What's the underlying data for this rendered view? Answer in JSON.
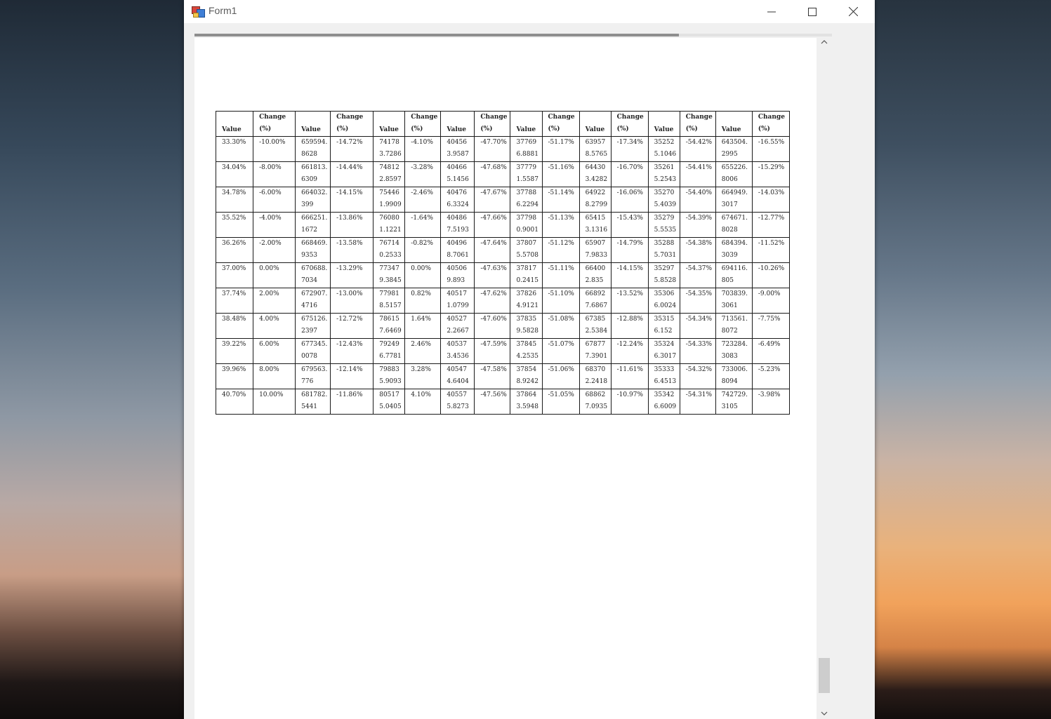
{
  "window": {
    "title": "Form1"
  },
  "titlebar_buttons": {
    "minimize": "minimize-icon",
    "maximize": "maximize-icon",
    "close": "close-icon"
  },
  "report": {
    "progress_percent": 76
  },
  "table": {
    "headers": [
      {
        "l1": "Value",
        "l2": ""
      },
      {
        "l1": "Change",
        "l2": "(%)"
      },
      {
        "l1": "Value",
        "l2": ""
      },
      {
        "l1": "Change",
        "l2": "(%)"
      },
      {
        "l1": "Value",
        "l2": ""
      },
      {
        "l1": "Change",
        "l2": "(%)"
      },
      {
        "l1": "Value",
        "l2": ""
      },
      {
        "l1": "Change",
        "l2": "(%)"
      },
      {
        "l1": "Value",
        "l2": ""
      },
      {
        "l1": "Change",
        "l2": "(%)"
      },
      {
        "l1": "Value",
        "l2": ""
      },
      {
        "l1": "Change",
        "l2": "(%)"
      },
      {
        "l1": "Value",
        "l2": ""
      },
      {
        "l1": "Change",
        "l2": "(%)"
      },
      {
        "l1": "Value",
        "l2": ""
      },
      {
        "l1": "Change",
        "l2": "(%)"
      }
    ],
    "rows": [
      [
        [
          "33.30%",
          ""
        ],
        [
          "-10.00%",
          ""
        ],
        [
          "659594.",
          "8628"
        ],
        [
          "-14.72%",
          ""
        ],
        [
          "74178",
          "3.7286"
        ],
        [
          "-4.10%",
          ""
        ],
        [
          "40456",
          "3.9587"
        ],
        [
          "-47.70%",
          ""
        ],
        [
          "37769",
          "6.8881"
        ],
        [
          "-51.17%",
          ""
        ],
        [
          "63957",
          "8.5765"
        ],
        [
          "-17.34%",
          ""
        ],
        [
          "35252",
          "5.1046"
        ],
        [
          "-54.42%",
          ""
        ],
        [
          "643504.",
          "2995"
        ],
        [
          "-16.55%",
          ""
        ]
      ],
      [
        [
          "34.04%",
          ""
        ],
        [
          "-8.00%",
          ""
        ],
        [
          "661813.",
          "6309"
        ],
        [
          "-14.44%",
          ""
        ],
        [
          "74812",
          "2.8597"
        ],
        [
          "-3.28%",
          ""
        ],
        [
          "40466",
          "5.1456"
        ],
        [
          "-47.68%",
          ""
        ],
        [
          "37779",
          "1.5587"
        ],
        [
          "-51.16%",
          ""
        ],
        [
          "64430",
          "3.4282"
        ],
        [
          "-16.70%",
          ""
        ],
        [
          "35261",
          "5.2543"
        ],
        [
          "-54.41%",
          ""
        ],
        [
          "655226.",
          "8006"
        ],
        [
          "-15.29%",
          ""
        ]
      ],
      [
        [
          "34.78%",
          ""
        ],
        [
          "-6.00%",
          ""
        ],
        [
          "664032.",
          "399"
        ],
        [
          "-14.15%",
          ""
        ],
        [
          "75446",
          "1.9909"
        ],
        [
          "-2.46%",
          ""
        ],
        [
          "40476",
          "6.3324"
        ],
        [
          "-47.67%",
          ""
        ],
        [
          "37788",
          "6.2294"
        ],
        [
          "-51.14%",
          ""
        ],
        [
          "64922",
          "8.2799"
        ],
        [
          "-16.06%",
          ""
        ],
        [
          "35270",
          "5.4039"
        ],
        [
          "-54.40%",
          ""
        ],
        [
          "664949.",
          "3017"
        ],
        [
          "-14.03%",
          ""
        ]
      ],
      [
        [
          "35.52%",
          ""
        ],
        [
          "-4.00%",
          ""
        ],
        [
          "666251.",
          "1672"
        ],
        [
          "-13.86%",
          ""
        ],
        [
          "76080",
          "1.1221"
        ],
        [
          "-1.64%",
          ""
        ],
        [
          "40486",
          "7.5193"
        ],
        [
          "-47.66%",
          ""
        ],
        [
          "37798",
          "0.9001"
        ],
        [
          "-51.13%",
          ""
        ],
        [
          "65415",
          "3.1316"
        ],
        [
          "-15.43%",
          ""
        ],
        [
          "35279",
          "5.5535"
        ],
        [
          "-54.39%",
          ""
        ],
        [
          "674671.",
          "8028"
        ],
        [
          "-12.77%",
          ""
        ]
      ],
      [
        [
          "36.26%",
          ""
        ],
        [
          "-2.00%",
          ""
        ],
        [
          "668469.",
          "9353"
        ],
        [
          "-13.58%",
          ""
        ],
        [
          "76714",
          "0.2533"
        ],
        [
          "-0.82%",
          ""
        ],
        [
          "40496",
          "8.7061"
        ],
        [
          "-47.64%",
          ""
        ],
        [
          "37807",
          "5.5708"
        ],
        [
          "-51.12%",
          ""
        ],
        [
          "65907",
          "7.9833"
        ],
        [
          "-14.79%",
          ""
        ],
        [
          "35288",
          "5.7031"
        ],
        [
          "-54.38%",
          ""
        ],
        [
          "684394.",
          "3039"
        ],
        [
          "-11.52%",
          ""
        ]
      ],
      [
        [
          "37.00%",
          ""
        ],
        [
          "0.00%",
          ""
        ],
        [
          "670688.",
          "7034"
        ],
        [
          "-13.29%",
          ""
        ],
        [
          "77347",
          "9.3845"
        ],
        [
          "0.00%",
          ""
        ],
        [
          "40506",
          "9.893"
        ],
        [
          "-47.63%",
          ""
        ],
        [
          "37817",
          "0.2415"
        ],
        [
          "-51.11%",
          ""
        ],
        [
          "66400",
          "2.835"
        ],
        [
          "-14.15%",
          ""
        ],
        [
          "35297",
          "5.8528"
        ],
        [
          "-54.37%",
          ""
        ],
        [
          "694116.",
          "805"
        ],
        [
          "-10.26%",
          ""
        ]
      ],
      [
        [
          "37.74%",
          ""
        ],
        [
          "2.00%",
          ""
        ],
        [
          "672907.",
          "4716"
        ],
        [
          "-13.00%",
          ""
        ],
        [
          "77981",
          "8.5157"
        ],
        [
          "0.82%",
          ""
        ],
        [
          "40517",
          "1.0799"
        ],
        [
          "-47.62%",
          ""
        ],
        [
          "37826",
          "4.9121"
        ],
        [
          "-51.10%",
          ""
        ],
        [
          "66892",
          "7.6867"
        ],
        [
          "-13.52%",
          ""
        ],
        [
          "35306",
          "6.0024"
        ],
        [
          "-54.35%",
          ""
        ],
        [
          "703839.",
          "3061"
        ],
        [
          "-9.00%",
          ""
        ]
      ],
      [
        [
          "38.48%",
          ""
        ],
        [
          "4.00%",
          ""
        ],
        [
          "675126.",
          "2397"
        ],
        [
          "-12.72%",
          ""
        ],
        [
          "78615",
          "7.6469"
        ],
        [
          "1.64%",
          ""
        ],
        [
          "40527",
          "2.2667"
        ],
        [
          "-47.60%",
          ""
        ],
        [
          "37835",
          "9.5828"
        ],
        [
          "-51.08%",
          ""
        ],
        [
          "67385",
          "2.5384"
        ],
        [
          "-12.88%",
          ""
        ],
        [
          "35315",
          "6.152"
        ],
        [
          "-54.34%",
          ""
        ],
        [
          "713561.",
          "8072"
        ],
        [
          "-7.75%",
          ""
        ]
      ],
      [
        [
          "39.22%",
          ""
        ],
        [
          "6.00%",
          ""
        ],
        [
          "677345.",
          "0078"
        ],
        [
          "-12.43%",
          ""
        ],
        [
          "79249",
          "6.7781"
        ],
        [
          "2.46%",
          ""
        ],
        [
          "40537",
          "3.4536"
        ],
        [
          "-47.59%",
          ""
        ],
        [
          "37845",
          "4.2535"
        ],
        [
          "-51.07%",
          ""
        ],
        [
          "67877",
          "7.3901"
        ],
        [
          "-12.24%",
          ""
        ],
        [
          "35324",
          "6.3017"
        ],
        [
          "-54.33%",
          ""
        ],
        [
          "723284.",
          "3083"
        ],
        [
          "-6.49%",
          ""
        ]
      ],
      [
        [
          "39.96%",
          ""
        ],
        [
          "8.00%",
          ""
        ],
        [
          "679563.",
          "776"
        ],
        [
          "-12.14%",
          ""
        ],
        [
          "79883",
          "5.9093"
        ],
        [
          "3.28%",
          ""
        ],
        [
          "40547",
          "4.6404"
        ],
        [
          "-47.58%",
          ""
        ],
        [
          "37854",
          "8.9242"
        ],
        [
          "-51.06%",
          ""
        ],
        [
          "68370",
          "2.2418"
        ],
        [
          "-11.61%",
          ""
        ],
        [
          "35333",
          "6.4513"
        ],
        [
          "-54.32%",
          ""
        ],
        [
          "733006.",
          "8094"
        ],
        [
          "-5.23%",
          ""
        ]
      ],
      [
        [
          "40.70%",
          ""
        ],
        [
          "10.00%",
          ""
        ],
        [
          "681782.",
          "5441"
        ],
        [
          "-11.86%",
          ""
        ],
        [
          "80517",
          "5.0405"
        ],
        [
          "4.10%",
          ""
        ],
        [
          "40557",
          "5.8273"
        ],
        [
          "-47.56%",
          ""
        ],
        [
          "37864",
          "3.5948"
        ],
        [
          "-51.05%",
          ""
        ],
        [
          "68862",
          "7.0935"
        ],
        [
          "-10.97%",
          ""
        ],
        [
          "35342",
          "6.6009"
        ],
        [
          "-54.31%",
          ""
        ],
        [
          "742729.",
          "3105"
        ],
        [
          "-3.98%",
          ""
        ]
      ]
    ]
  }
}
